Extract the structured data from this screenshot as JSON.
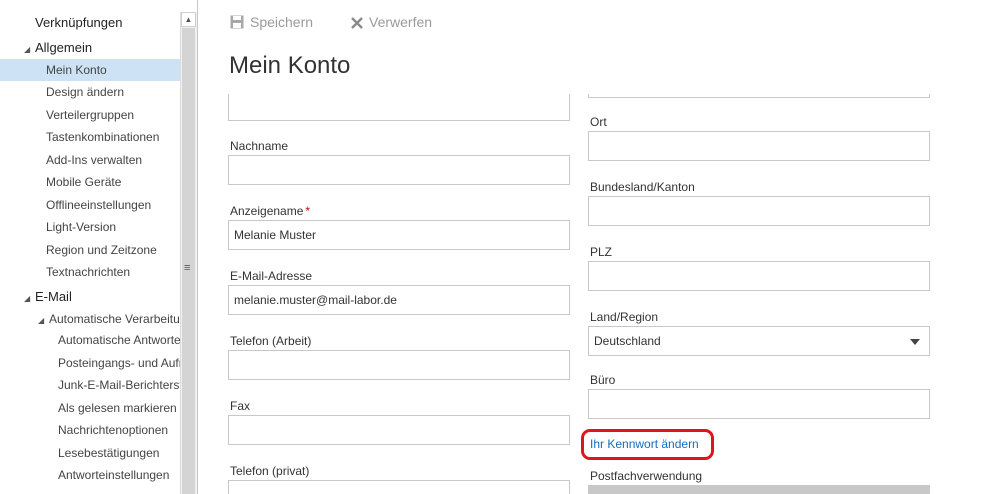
{
  "sidebar": {
    "header": "Verknüpfungen",
    "section_general": "Allgemein",
    "general_items": [
      "Mein Konto",
      "Design ändern",
      "Verteilergruppen",
      "Tastenkombinationen",
      "Add-Ins verwalten",
      "Mobile Geräte",
      "Offlineeinstellungen",
      "Light-Version",
      "Region und Zeitzone",
      "Textnachrichten"
    ],
    "section_email": "E-Mail",
    "subsection_auto": "Automatische Verarbeitung",
    "auto_items": [
      "Automatische Antworten",
      "Posteingangs- und Aufräumregeln",
      "Junk-E-Mail-Berichterstattung",
      "Als gelesen markieren",
      "Nachrichtenoptionen",
      "Lesebestätigungen",
      "Antworteinstellungen"
    ]
  },
  "toolbar": {
    "save_label": "Speichern",
    "discard_label": "Verwerfen"
  },
  "page_title": "Mein Konto",
  "form": {
    "nachname_label": "Nachname",
    "nachname_value": "",
    "anzeigename_label": "Anzeigename",
    "required_mark": "*",
    "anzeigename_value": "Melanie Muster",
    "email_label": "E-Mail-Adresse",
    "email_value": "melanie.muster@mail-labor.de",
    "telefon_arbeit_label": "Telefon (Arbeit)",
    "fax_label": "Fax",
    "telefon_privat_label": "Telefon (privat)",
    "ort_label": "Ort",
    "bundesland_label": "Bundesland/Kanton",
    "plz_label": "PLZ",
    "land_label": "Land/Region",
    "land_value": "Deutschland",
    "buero_label": "Büro",
    "change_password_link": "Ihr Kennwort ändern",
    "postfach_label": "Postfachverwendung"
  },
  "colors": {
    "selected_bg": "#cde3f5",
    "link": "#106ebe",
    "highlight": "#e0141e",
    "required": "#cc0000"
  }
}
